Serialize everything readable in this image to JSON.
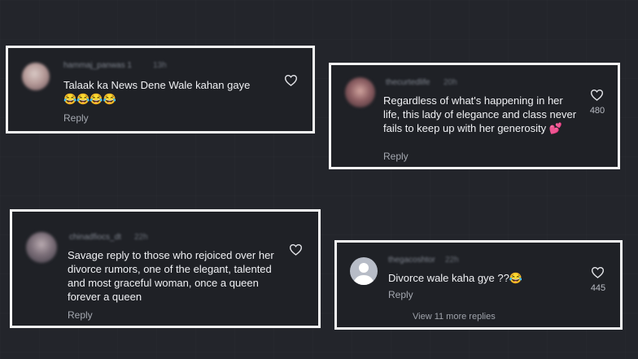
{
  "comments": [
    {
      "username": "hammaj_panwas 1",
      "age": "13h",
      "text": "Talaak ka News Dene Wale kahan gaye 😂😂😂😂",
      "reply_label": "Reply",
      "likes": ""
    },
    {
      "username": "thecurtedlife",
      "age": "20h",
      "text": "Regardless of what's happening in her life, this lady of elegance and class never fails to keep up with her generosity 💕",
      "reply_label": "Reply",
      "likes": "480"
    },
    {
      "username": "chinadfiocs_dt",
      "age": "22h",
      "text": "Savage reply to those who rejoiced over her divorce rumors, one of the elegant, talented and most graceful woman, once a queen forever a queen",
      "reply_label": "Reply",
      "likes": ""
    },
    {
      "username": "thegacoshtor",
      "age": "22h",
      "text": "Divorce wale kaha gye ??😂",
      "reply_label": "Reply",
      "likes": "445",
      "more_replies": "View 11 more replies"
    }
  ],
  "icons": {
    "like": "heart-outline-icon",
    "default_avatar": "user-silhouette-icon"
  },
  "colors": {
    "background": "#23252b",
    "highlight_border": "#f4f4f4",
    "text_primary": "#f0f1f4",
    "text_secondary": "#a4a8b0"
  }
}
